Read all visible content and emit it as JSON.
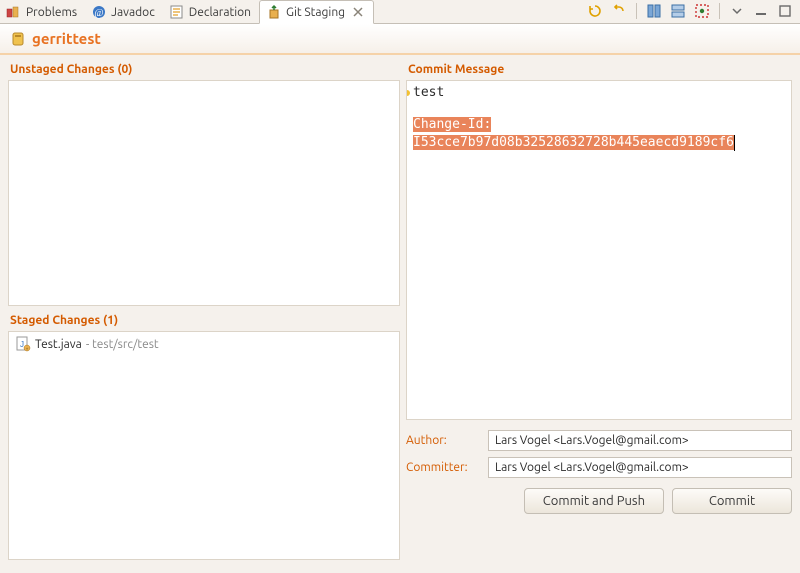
{
  "tabs": [
    {
      "label": "Problems"
    },
    {
      "label": "Javadoc"
    },
    {
      "label": "Declaration"
    },
    {
      "label": "Git Staging"
    }
  ],
  "project_title": "gerrittest",
  "unstaged": {
    "label": "Unstaged Changes (0)"
  },
  "staged": {
    "label": "Staged Changes (1)",
    "file_name": "Test.java",
    "file_path": " - test/src/test"
  },
  "commit": {
    "label": "Commit Message",
    "line1": "test",
    "selected": "Change-Id:\nI53cce7b97d08b32528632728b445eaecd9189cf6"
  },
  "author": {
    "label": "Author:",
    "value": "Lars Vogel <Lars.Vogel@gmail.com>"
  },
  "committer": {
    "label": "Committer:",
    "value": "Lars Vogel <Lars.Vogel@gmail.com>"
  },
  "buttons": {
    "commit_push": "Commit and Push",
    "commit": "Commit"
  }
}
